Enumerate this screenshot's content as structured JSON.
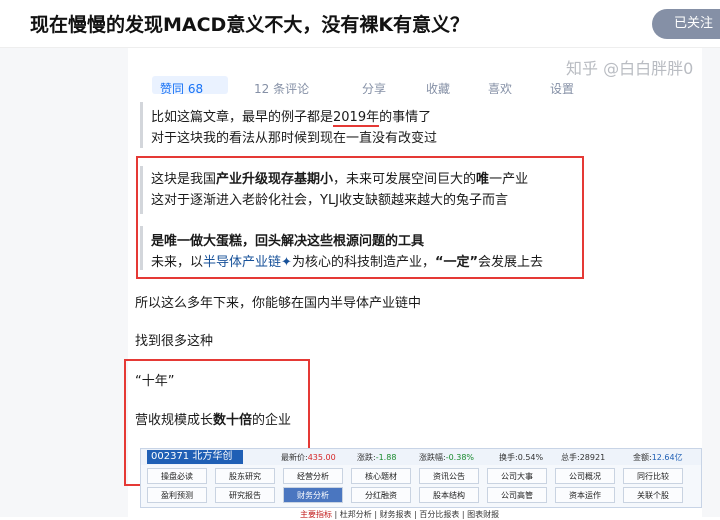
{
  "header": {
    "title": "现在慢慢的发现MACD意义不大，没有裸K有意义？",
    "follow_label": "已关注"
  },
  "watermark": "知乎 @白白胖胖0",
  "toolbar": [
    "赞同 68",
    "12 条评论",
    "分享",
    "收藏",
    "喜欢",
    "设置"
  ],
  "article": {
    "quote1": {
      "line1_pre": "比如这篇文章，最早的例子都是",
      "line1_year": "2019年",
      "line1_post": "的事情了",
      "line2": "对于这块我的看法从那时候到现在一直没有改变过"
    },
    "box1": {
      "line1_a": "这块是我国",
      "line1_b": "产业升级现存基期小",
      "line1_c": "，未来可发展空间巨大的",
      "line1_d": "唯",
      "line1_e": "一产业",
      "line2": "这对于逐渐进入老龄化社会，YLJ收支缺额越来越大的兔子而言",
      "line3": "是唯一做大蛋糕，回头解决这些根源问题的工具",
      "line4_a": "未来，以",
      "line4_b": "半导体产业链",
      "line4_c": "✦",
      "line4_d": "为核心的科技制造产业，",
      "line4_e": "“一定”",
      "line4_f": "会发展上去"
    },
    "para1": "所以这么多年下来，你能够在国内半导体产业链中",
    "para2": "找到很多这种",
    "box2": {
      "line1": "“十年”",
      "line2_a": "营收规模成长",
      "line2_b": "数十倍",
      "line2_c": "的企业"
    }
  },
  "stock": {
    "code_name": "002371  北方华创",
    "fields": {
      "latest_label": "最新价:",
      "latest_value": "435.00",
      "change_label": "涨跌:",
      "change_value": "-1.88",
      "pct_label": "涨跌幅:",
      "pct_value": "-0.38%",
      "turnover_label": "换手:",
      "turnover_value": "0.54%",
      "volume_label": "总手:",
      "volume_value": "28921",
      "amount_label": "金额:",
      "amount_value": "12.64亿"
    },
    "tabs_row1": [
      "操盘必读",
      "股东研究",
      "经营分析",
      "核心题材",
      "资讯公告",
      "公司大事",
      "公司概况",
      "同行比较"
    ],
    "tabs_row2": [
      "盈利预测",
      "研究报告",
      "财务分析",
      "分红融资",
      "股本结构",
      "公司高管",
      "资本运作",
      "关联个股"
    ],
    "active_tab": "财务分析",
    "subnav": {
      "item1": "主要指标",
      "item2": "杜邦分析",
      "item3": "财务报表",
      "item4": "百分比报表",
      "item5": "图表财报"
    }
  }
}
